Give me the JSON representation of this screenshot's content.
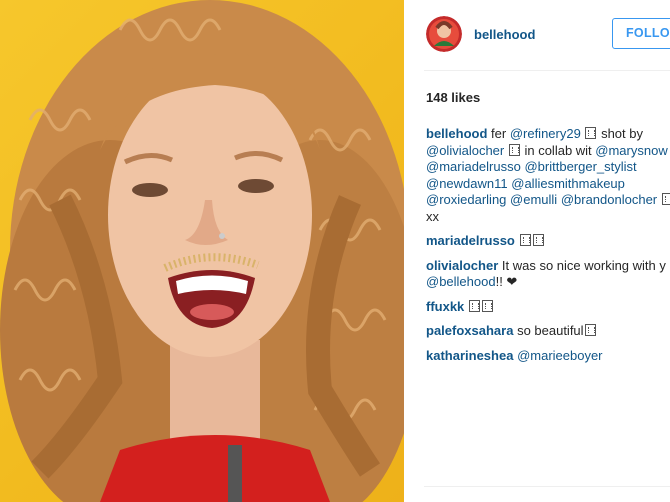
{
  "post": {
    "username": "bellehood",
    "follow_label": "FOLLOW",
    "likes": "148 likes",
    "avatar_icon": "profile-avatar-icon"
  },
  "caption": {
    "user": "bellehood",
    "line1_a": "fer ",
    "line1_mention": "@refinery29",
    "line1_b": " shot by",
    "line2_mention": "@olivialocher",
    "line2_b": " in collab wit ",
    "line2_mention2": "@marysnow",
    "line3_a": "@mariadelrusso",
    "line3_b": "@brittberger_stylist",
    "line4_a": "@newdawn11",
    "line4_b": "@alliesmithmakeup",
    "line5_a": "@roxiedarling",
    "line5_b": "@emulli",
    "line5_c": "@brandonlocher",
    "line6": "xx"
  },
  "comments": [
    {
      "user": "mariadelrusso",
      "text": ""
    },
    {
      "user": "olivialocher",
      "text": "It was so nice working with y",
      "mention": "@bellehood",
      "tail": "!! ❤"
    },
    {
      "user": "ffuxkk",
      "text": ""
    },
    {
      "user": "palefoxsahara",
      "text": "so beautiful"
    },
    {
      "user": "katharineshea",
      "mention": "@marieeboyer"
    }
  ],
  "colors": {
    "link": "#125688",
    "follow": "#3897f0",
    "background_photo": "#f2bb1f"
  }
}
